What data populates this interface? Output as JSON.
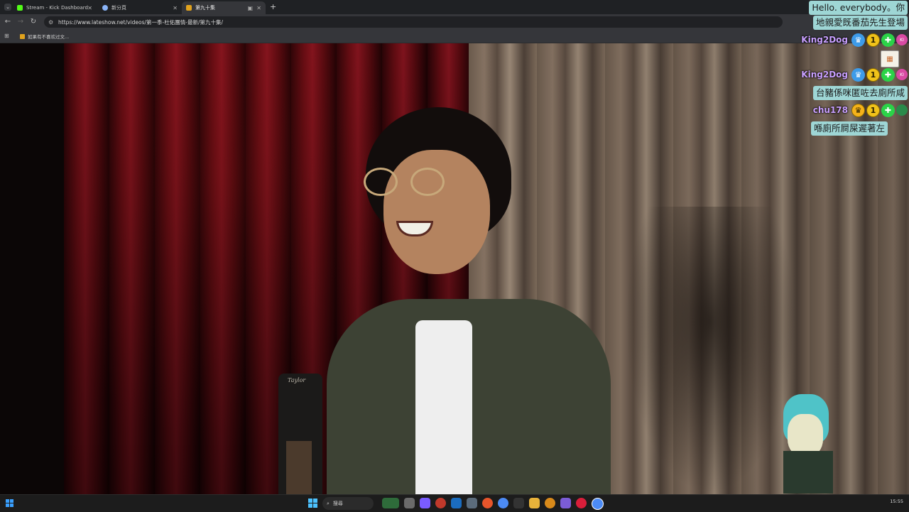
{
  "browser": {
    "tabs": [
      {
        "label": "Stream - Kick Dashboard",
        "color": "#53fc18"
      },
      {
        "label": "新分頁",
        "color": "#8ab4f8"
      },
      {
        "label": "第九十集",
        "color": "#e0a21d"
      }
    ],
    "url": "https://www.lateshow.net/videos/第一季-杜佑團情-最新/第九十集/",
    "bookmark": "如果有不喜欢过文..."
  },
  "video": {
    "guitar_brand": "Taylor"
  },
  "chat": {
    "messages": [
      {
        "type": "text",
        "text": "Hello. everybody。你"
      },
      {
        "type": "text",
        "text": "地親愛既番茄先生登場"
      },
      {
        "type": "user",
        "username": "King2Dog",
        "badges": [
          "crown",
          "1",
          "plus"
        ],
        "avatar": "KI"
      },
      {
        "type": "emote"
      },
      {
        "type": "user",
        "username": "King2Dog",
        "badges": [
          "crown",
          "1",
          "plus"
        ],
        "avatar": "KI"
      },
      {
        "type": "text",
        "text": "台豬係咪匿咗去廁所咸"
      },
      {
        "type": "user",
        "username": "chu178",
        "badges": [
          "crown",
          "1",
          "plus"
        ],
        "avatar": ""
      },
      {
        "type": "text",
        "text": "喺廁所屙屎遲著左"
      }
    ],
    "colors": {
      "bubble": "#9ed6d5",
      "username": "#c9a0ff"
    }
  },
  "taskbar": {
    "search_label": "搜尋",
    "clock": "15:55"
  }
}
